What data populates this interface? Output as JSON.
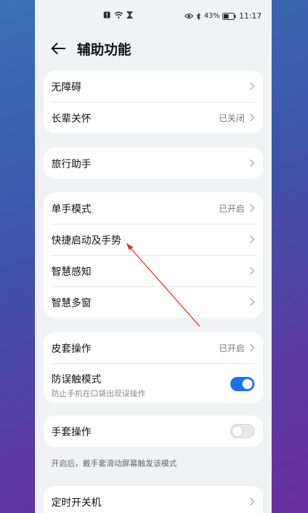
{
  "statusbar": {
    "battery_percent": "43%",
    "time": "11:17"
  },
  "header": {
    "title": "辅助功能"
  },
  "group1": {
    "accessibility": "无障碍",
    "elderly_care": "长辈关怀",
    "elderly_care_value": "已关闭"
  },
  "group2": {
    "travel_assistant": "旅行助手"
  },
  "group3": {
    "one_hand_mode": "单手模式",
    "one_hand_mode_value": "已开启",
    "shortcuts_gestures": "快捷启动及手势",
    "smart_sensing": "智慧感知",
    "smart_multiwindow": "智慧多窗"
  },
  "group4": {
    "cover_operation": "皮套操作",
    "cover_operation_value": "已开启",
    "mistouch_mode": "防误触模式",
    "mistouch_desc": "防止手机在口袋出现误操作",
    "mistouch_on": true
  },
  "group5": {
    "glove_operation": "手套操作",
    "glove_on": false,
    "glove_hint": "开启后，戴手套滑动屏幕触发该模式"
  },
  "group6": {
    "scheduled_power": "定时开关机"
  },
  "colors": {
    "accent": "#1e6ff0",
    "annotation_arrow": "#d9362b"
  }
}
